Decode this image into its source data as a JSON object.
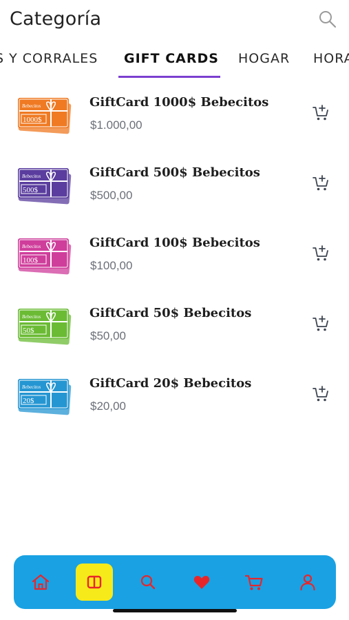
{
  "header": {
    "title": "Categoría"
  },
  "tabs": [
    {
      "label": "S Y CORRALES"
    },
    {
      "label": "GIFT CARDS"
    },
    {
      "label": "HOGAR"
    },
    {
      "label": "HORA"
    }
  ],
  "products": [
    {
      "name": "GiftCard 1000$ Bebecitos",
      "price": "$1.000,00",
      "card_color": "#ef7a23",
      "card_text": "1000$",
      "brand_text": "Bebecitos"
    },
    {
      "name": "GiftCard 500$ Bebecitos",
      "price": "$500,00",
      "card_color": "#5a3d9e",
      "card_text": "500$",
      "brand_text": "Bebecitos"
    },
    {
      "name": "GiftCard 100$ Bebecitos",
      "price": "$100,00",
      "card_color": "#cf3e9b",
      "card_text": "100$",
      "brand_text": "Bebecitos"
    },
    {
      "name": "GiftCard 50$ Bebecitos",
      "price": "$50,00",
      "card_color": "#6bbb35",
      "card_text": "50$",
      "brand_text": "Bebecitos"
    },
    {
      "name": "GiftCard 20$ Bebecitos",
      "price": "$20,00",
      "card_color": "#2596d2",
      "card_text": "20$",
      "brand_text": "Bebecitos"
    }
  ],
  "bottom_nav": {
    "items": [
      {
        "icon": "home-icon"
      },
      {
        "icon": "categories-icon",
        "selected": true
      },
      {
        "icon": "search-icon"
      },
      {
        "icon": "heart-icon"
      },
      {
        "icon": "cart-icon"
      },
      {
        "icon": "user-icon"
      }
    ]
  },
  "colors": {
    "accent_underline": "#7b3fd0",
    "nav_background": "#1aa1e3",
    "nav_selected": "#f7ea1a",
    "nav_icon": "#e8262a"
  }
}
